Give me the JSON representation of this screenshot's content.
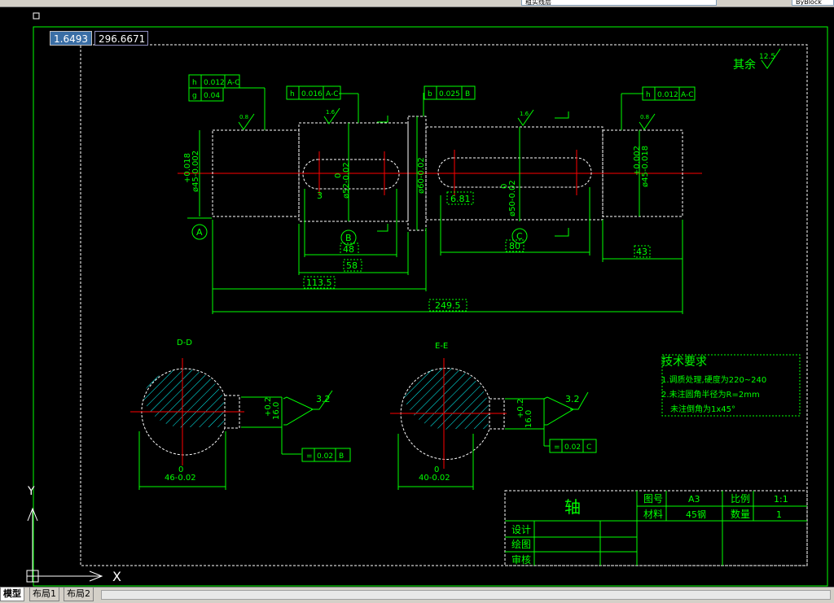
{
  "toolbar": {
    "layer_name": "粗实线层",
    "linetype": "ByBlock"
  },
  "coords": {
    "x": "1.6493",
    "y": "296.6671"
  },
  "tabs": [
    "模型",
    "布局1",
    "布局2"
  ],
  "drawing": {
    "surface_finish_note": "其余",
    "surface_finish_value": "12.5",
    "tol_top_left_1": [
      "h",
      "0.012",
      "A-C"
    ],
    "tol_top_left_2": [
      "g",
      "0.04"
    ],
    "tol_top_mid": [
      "h",
      "0.016",
      "A-C"
    ],
    "tol_top_mid2": [
      "b",
      "0.025",
      "B"
    ],
    "tol_top_right": [
      "h",
      "0.012",
      "A-C"
    ],
    "roughness_1": "0.8",
    "roughness_2": "1.6",
    "roughness_3": "1.6",
    "roughness_4": "0.8",
    "dim_d1": "ø45+0.018/-0.002",
    "dim_d1_upper": "+0.018",
    "dim_d1_lower": "ø45-0.002",
    "dim_d2_upper": "0",
    "dim_d2_lower": "ø52-0.02",
    "dim_d3": "ø60-0.02",
    "dim_d4_upper": "0",
    "dim_d4_lower": "ø50-0.02",
    "dim_d5_upper": "+0.002",
    "dim_d5_lower": "ø45-0.018",
    "dim_3": "3",
    "dim_6_81": "6.81",
    "dim_48": "48",
    "dim_58": "58",
    "dim_113_5": "113.5",
    "dim_80": "80",
    "dim_43": "43",
    "dim_249_5": "249.5",
    "datum_a": "A",
    "datum_b": "B",
    "datum_c": "C",
    "section_d_label": "D-D",
    "section_e_label": "E-E",
    "section_d": {
      "width_tol": "+0.2",
      "width": "16.0",
      "dia_upper": "0",
      "dia": "46-0.02",
      "roughness": "3.2",
      "tol": [
        "=",
        "0.02",
        "B"
      ]
    },
    "section_e": {
      "width_tol": "+0.2",
      "width": "16.0",
      "dia_upper": "0",
      "dia": "40-0.02",
      "roughness": "3.2",
      "tol": [
        "=",
        "0.02",
        "C"
      ]
    },
    "tech_req_title": "技术要求",
    "tech_req_1": "1.调质处理,硬度为220~240",
    "tech_req_2": "2.未注圆角半径为R=2mm",
    "tech_req_3": "未注倒角为1x45°",
    "title_block": {
      "part_name": "轴",
      "drawing_no_label": "图号",
      "drawing_no": "A3",
      "scale_label": "比例",
      "scale": "1:1",
      "material_label": "材料",
      "material": "45钢",
      "qty_label": "数量",
      "qty": "1",
      "design_label": "设计",
      "draw_label": "绘图",
      "review_label": "审核"
    },
    "ucs_x": "X",
    "ucs_y": "Y"
  },
  "colors": {
    "bg": "#000000",
    "green": "#00ff00",
    "red": "#ff0000",
    "cyan": "#00ffff",
    "white": "#ffffff"
  }
}
